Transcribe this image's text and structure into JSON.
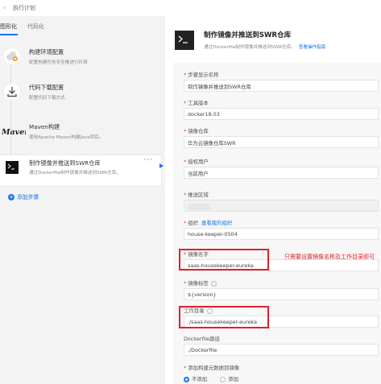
{
  "topbar": {
    "back_glyph": "‹",
    "title": "执行计划"
  },
  "left": {
    "tabs": [
      {
        "label": "图形化",
        "active": true
      },
      {
        "label": "代码化",
        "active": false
      }
    ],
    "steps": [
      {
        "title": "构建环境配置",
        "desc": "配置构建任务安全推进行环境",
        "icon": "cloud-settings-icon"
      },
      {
        "title": "代码下载配置",
        "desc": "配置代码下载方式",
        "icon": "download-icon"
      },
      {
        "title": "Maven构建",
        "desc": "使用Apache Maven构建Java项目。",
        "icon": "maven-logo"
      },
      {
        "title": "制作镜像并推送到SWR仓库",
        "desc": "通过Dockerfile制作镜像并推送到SWR仓库。",
        "icon": "terminal-icon"
      }
    ],
    "more_glyph": "···",
    "add_step_label": "添加步骤"
  },
  "panel": {
    "title": "制作镜像并推送到SWR仓库",
    "desc": "通过Dockerfile制作镜像并推送到SWR仓库。",
    "doc_link": "查看操作指南",
    "fields": [
      {
        "label": "步骤显示名称",
        "required": true,
        "value": "制作镜像并推送到SWR仓库"
      },
      {
        "label": "工具版本",
        "required": true,
        "value": "docker18.03"
      },
      {
        "label": "镜像仓库",
        "required": true,
        "value": "华为云镜像仓库SWR"
      },
      {
        "label": "授权用户",
        "required": true,
        "value": "当前用户"
      },
      {
        "label": "推送区域",
        "required": true,
        "value": ""
      },
      {
        "label": "组织",
        "required": true,
        "link": "查看我的组织",
        "value": "house-keeper-0504"
      },
      {
        "label": "镜像名字",
        "required": true,
        "value": "saas-housekeeper-eureka"
      },
      {
        "label": "镜像标签",
        "required": true,
        "value": "${version}"
      },
      {
        "label": "工作目录",
        "required": false,
        "value": "./saas-housekeeper-eureka"
      },
      {
        "label": "Dockerfile路径",
        "required": false,
        "value": "./Dockerfile"
      }
    ],
    "annotation": "只需要设置镜像名称及工作目录即可",
    "radio_label": "添加构建元数据到镜像",
    "radio_options": [
      {
        "label": "不添加",
        "selected": true
      },
      {
        "label": "添加",
        "selected": false
      }
    ]
  },
  "colors": {
    "accent": "#1a73e8",
    "annotation_red": "#e0202a",
    "left_bg": "#f3f3f3"
  }
}
